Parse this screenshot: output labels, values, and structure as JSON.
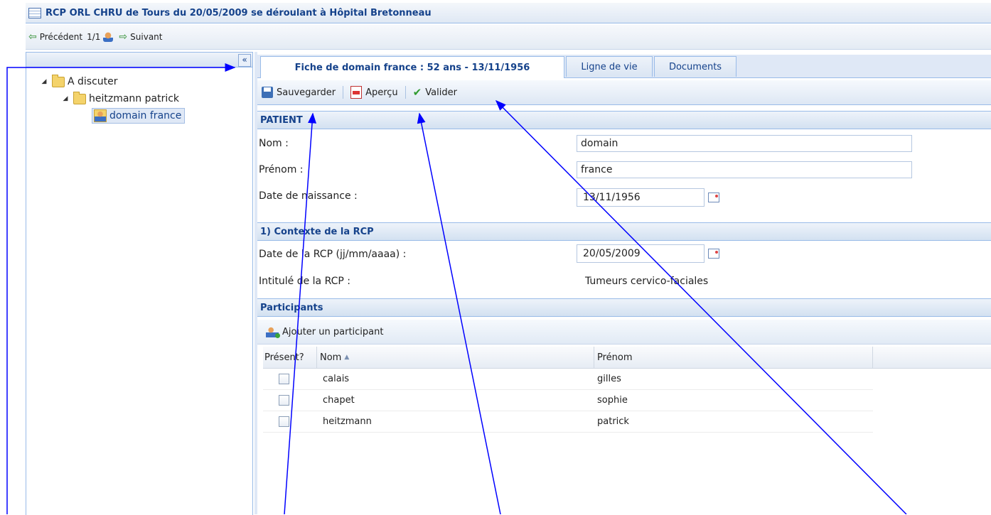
{
  "window": {
    "title": "RCP ORL CHRU de Tours du 20/05/2009 se déroulant à Hôpital Bretonneau"
  },
  "nav": {
    "prev_label": "Précédent",
    "count": "1/1",
    "next_label": "Suivant"
  },
  "left_panel": {
    "collapse_label": "«",
    "tree": {
      "root": "A discuter",
      "child": "heitzmann patrick",
      "leaf": "domain france"
    }
  },
  "tabs": [
    {
      "label": "Fiche de domain france : 52 ans - 13/11/1956",
      "active": true
    },
    {
      "label": "Ligne de vie",
      "active": false
    },
    {
      "label": "Documents",
      "active": false
    }
  ],
  "toolbar": {
    "save_label": "Sauvegarder",
    "preview_label": "Aperçu",
    "validate_label": "Valider"
  },
  "patient": {
    "section_title": "PATIENT",
    "nom_label": "Nom :",
    "nom_value": "domain",
    "prenom_label": "Prénom :",
    "prenom_value": "france",
    "dob_label": "Date de naissance :",
    "dob_value": "13/11/1956"
  },
  "context": {
    "section_title": "1) Contexte de la RCP",
    "date_label": "Date de la RCP (jj/mm/aaaa) :",
    "date_value": "20/05/2009",
    "title_label": "Intitulé de la RCP :",
    "title_value": "Tumeurs cervico-faciales"
  },
  "participants": {
    "section_title": "Participants",
    "add_label": "Ajouter un participant",
    "columns": {
      "present": "Présent?",
      "nom": "Nom",
      "sort": "▲",
      "prenom": "Prénom"
    },
    "rows": [
      {
        "nom": "calais",
        "prenom": "gilles"
      },
      {
        "nom": "chapet",
        "prenom": "sophie"
      },
      {
        "nom": "heitzmann",
        "prenom": "patrick"
      }
    ]
  },
  "colors": {
    "accent": "#15428b",
    "border": "#99bbe8",
    "annotation": "#0000ff"
  },
  "icons": [
    "grid-icon",
    "left-arrow-icon",
    "user-icon",
    "right-arrow-icon",
    "collapse-icon",
    "folder-icon",
    "save-icon",
    "pdf-icon",
    "check-icon",
    "calendar-icon",
    "add-user-icon",
    "checkbox-icon"
  ]
}
